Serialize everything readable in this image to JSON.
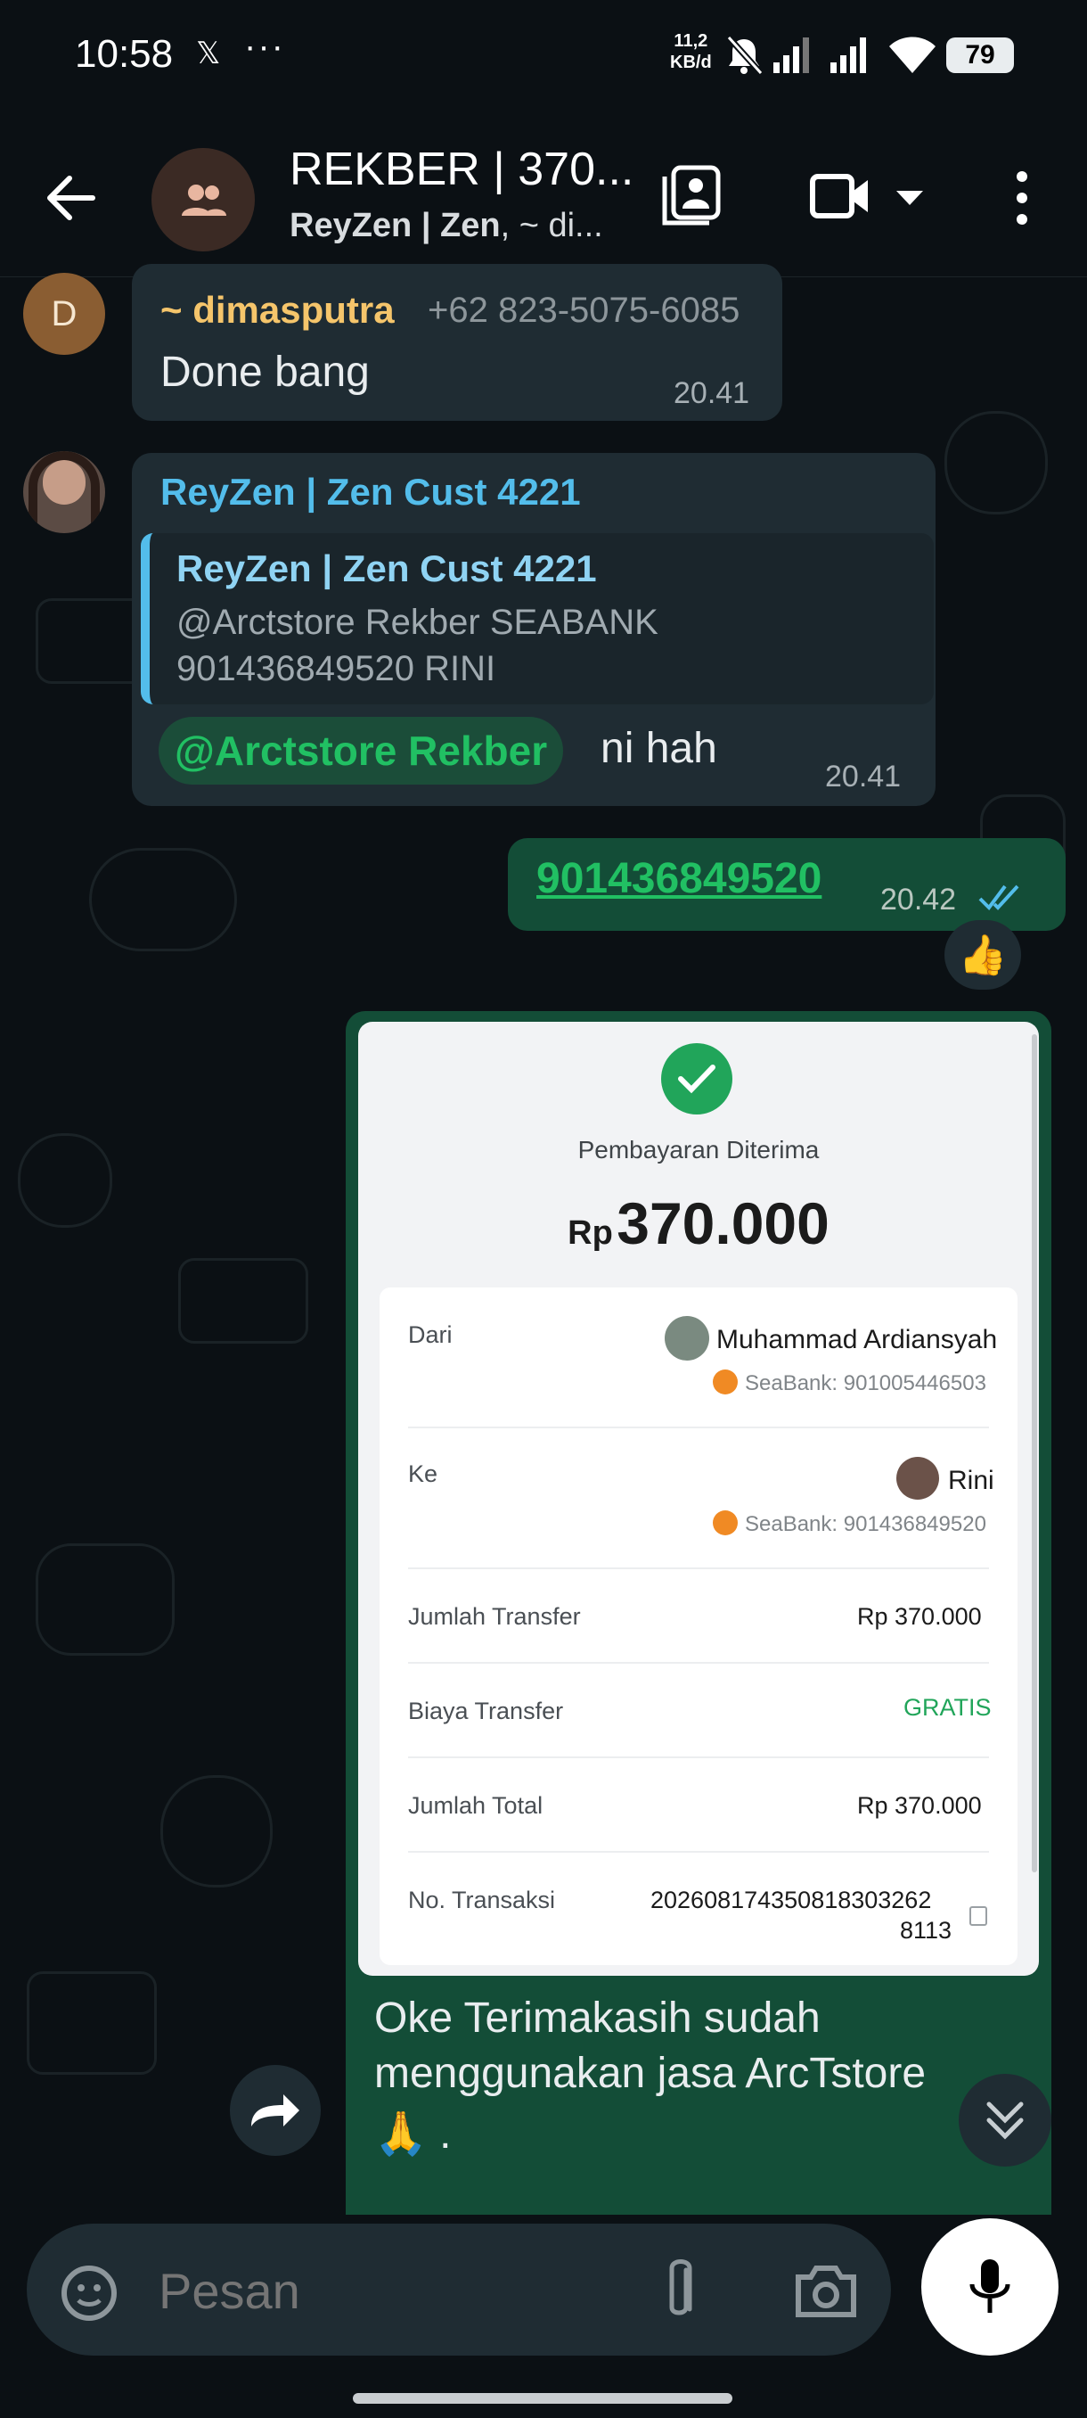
{
  "status_bar": {
    "time": "10:58",
    "x_icon": "x-logo-icon",
    "more": "···",
    "net_speed_value": "11,2",
    "net_speed_unit": "KB/d",
    "battery": "79"
  },
  "header": {
    "title": "REKBER | 370...",
    "subtitle_bold": "ReyZen | Zen",
    "subtitle_rest": ", ~ di..."
  },
  "messages": {
    "m1": {
      "avatar_letter": "D",
      "sender": "~ dimasputra",
      "phone": "+62 823-5075-6085",
      "text": "Done bang",
      "time": "20.41"
    },
    "m2": {
      "sender": "ReyZen | Zen Cust 4221",
      "quote_sender": "ReyZen | Zen Cust 4221",
      "quote_line1": "@Arctstore Rekber SEABANK",
      "quote_line2": "901436849520 RINI",
      "mention": "@Arctstore Rekber",
      "text": "ni hah",
      "time": "20.41"
    },
    "m3": {
      "text": "901436849520",
      "time": "20.42",
      "reaction": "👍"
    },
    "m4": {
      "caption_line1": "Oke Terimakasih sudah",
      "caption_line2": "menggunakan jasa ArcTstore",
      "caption_line3": "🙏 ."
    }
  },
  "receipt": {
    "status": "Pembayaran Diterima",
    "currency": "Rp",
    "amount": "370.000",
    "from_label": "Dari",
    "from_name": "Muhammad Ardiansyah",
    "from_bank": "SeaBank: 901005446503",
    "to_label": "Ke",
    "to_name": "Rini",
    "to_bank": "SeaBank: 901436849520",
    "transfer_label": "Jumlah Transfer",
    "transfer_value": "Rp 370.000",
    "fee_label": "Biaya Transfer",
    "fee_value": "GRATIS",
    "total_label": "Jumlah Total",
    "total_value": "Rp 370.000",
    "trx_label": "No. Transaksi",
    "trx_line1": "20260817435081830326​2",
    "trx_line2": "8113"
  },
  "input": {
    "placeholder": "Pesan"
  },
  "colors": {
    "background": "#0b1014",
    "incoming_bubble": "#1f2c33",
    "outgoing_bubble": "#134d37",
    "accent_green": "#21c063",
    "sender_orange": "#f5c56b",
    "sender_blue": "#53bdeb",
    "read_ticks": "#53bdeb"
  }
}
